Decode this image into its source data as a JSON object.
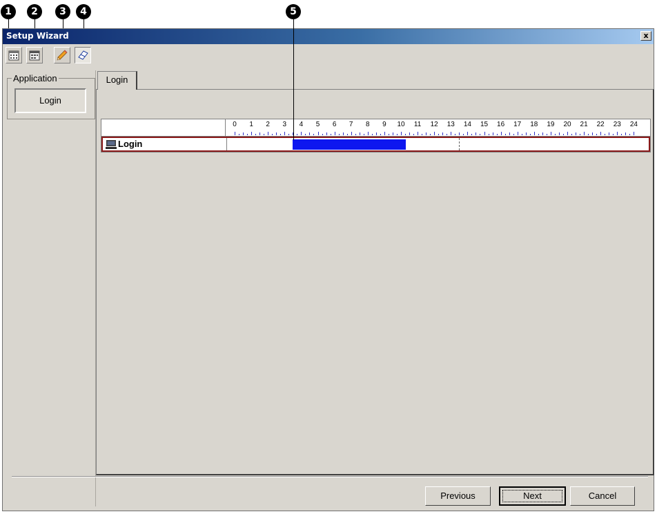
{
  "callouts": [
    "1",
    "2",
    "3",
    "4",
    "5"
  ],
  "window": {
    "title": "Setup Wizard",
    "close_label": "x"
  },
  "toolbar": {
    "icons": [
      "calendar-icon",
      "calendar-icon",
      "pencil-icon",
      "eraser-icon"
    ],
    "active": "eraser-icon"
  },
  "application_group": {
    "legend": "Application",
    "selected_item": "Login"
  },
  "tabs": [
    {
      "label": "Login"
    }
  ],
  "schedule": {
    "hours": [
      "0",
      "1",
      "2",
      "3",
      "4",
      "5",
      "6",
      "7",
      "8",
      "9",
      "10",
      "11",
      "12",
      "13",
      "14",
      "15",
      "16",
      "17",
      "18",
      "19",
      "20",
      "21",
      "22",
      "23",
      "24"
    ],
    "rows": [
      {
        "label": "Login",
        "icon": "computer-icon",
        "start_hour": 3.5,
        "end_hour": 10.3
      }
    ],
    "current_hour": 13.5
  },
  "buttons": {
    "previous": "Previous",
    "next": "Next",
    "cancel": "Cancel"
  },
  "colors": {
    "title_bar": "#0a246a",
    "bar": "#0d17f0",
    "row_border": "#8b1a1a",
    "ticks": "#3030c8",
    "window_bg": "#d9d6cf"
  }
}
